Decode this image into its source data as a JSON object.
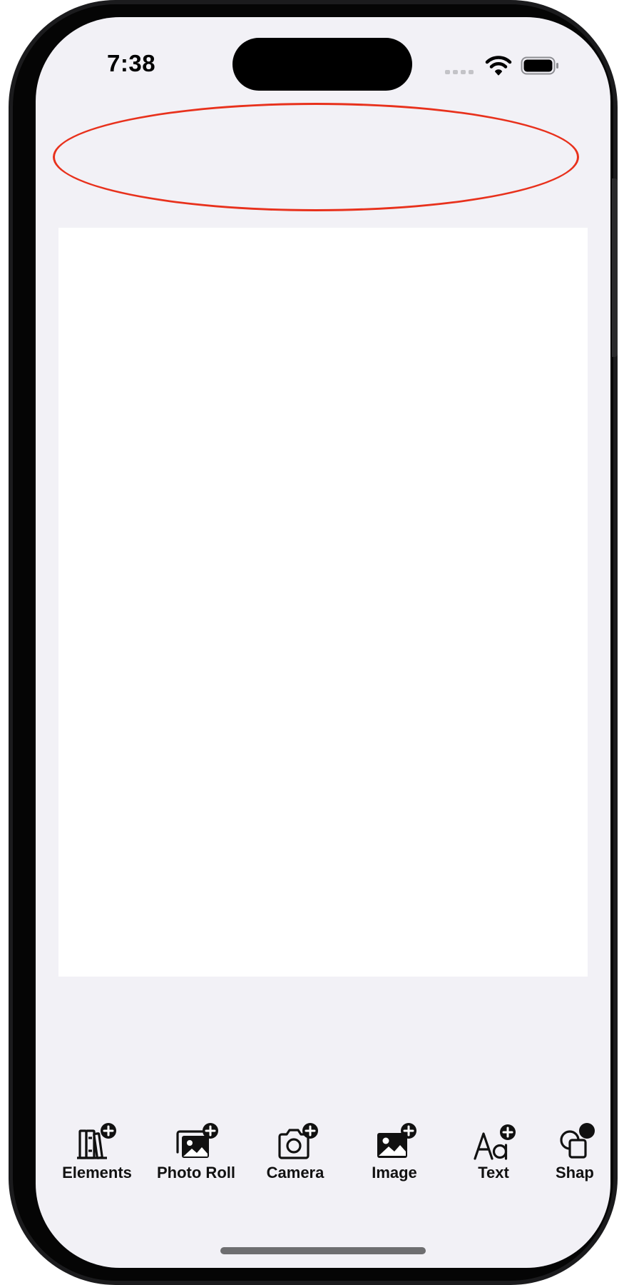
{
  "status_bar": {
    "time": "7:38"
  },
  "toolbar": {
    "items": [
      {
        "label": "Elements",
        "icon": "books-plus-icon"
      },
      {
        "label": "Photo Roll",
        "icon": "photo-stack-plus-icon"
      },
      {
        "label": "Camera",
        "icon": "camera-plus-icon"
      },
      {
        "label": "Image",
        "icon": "image-plus-icon"
      },
      {
        "label": "Text",
        "icon": "text-aa-plus-icon"
      },
      {
        "label": "Shap",
        "icon": "shapes-icon"
      }
    ]
  },
  "colors": {
    "screen_background": "#f2f1f6",
    "canvas_background": "#ffffff",
    "annotation_ellipse": "#e8311c",
    "icon_color": "#111111"
  }
}
